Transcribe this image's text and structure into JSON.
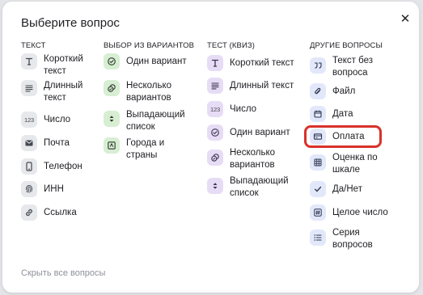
{
  "dialog": {
    "title": "Выберите вопрос",
    "close_glyph": "✕",
    "hide_all": "Скрыть все вопросы"
  },
  "columns": [
    {
      "header": "ТЕКСТ",
      "color": "#e7e8eb",
      "items": [
        {
          "label": "Короткий текст",
          "icon": "text-t-icon"
        },
        {
          "label": "Длинный текст",
          "icon": "long-text-icon"
        },
        {
          "label": "Число",
          "icon": "number-icon"
        },
        {
          "label": "Почта",
          "icon": "mail-icon"
        },
        {
          "label": "Телефон",
          "icon": "phone-icon"
        },
        {
          "label": "ИНН",
          "icon": "fingerprint-icon"
        },
        {
          "label": "Ссылка",
          "icon": "link-icon"
        }
      ]
    },
    {
      "header": "ВЫБОР ИЗ ВАРИАНТОВ",
      "color": "#d7eed3",
      "items": [
        {
          "label": "Один вариант",
          "icon": "radio-check-icon"
        },
        {
          "label": "Несколько вариантов",
          "icon": "multi-choice-icon"
        },
        {
          "label": "Выпадающий список",
          "icon": "dropdown-icon"
        },
        {
          "label": "Города и страны",
          "icon": "map-icon"
        }
      ]
    },
    {
      "header": "ТЕСТ (КВИЗ)",
      "color": "#e7dcf5",
      "items": [
        {
          "label": "Короткий текст",
          "icon": "text-t-icon"
        },
        {
          "label": "Длинный текст",
          "icon": "long-text-icon"
        },
        {
          "label": "Число",
          "icon": "number-icon"
        },
        {
          "label": "Один вариант",
          "icon": "radio-check-icon"
        },
        {
          "label": "Несколько вариантов",
          "icon": "multi-choice-icon"
        },
        {
          "label": "Выпадающий список",
          "icon": "dropdown-icon"
        }
      ]
    },
    {
      "header": "ДРУГИЕ ВОПРОСЫ",
      "color": "#e2e8fa",
      "items": [
        {
          "label": "Текст без вопроса",
          "icon": "quote-icon"
        },
        {
          "label": "Файл",
          "icon": "paperclip-icon"
        },
        {
          "label": "Дата",
          "icon": "calendar-icon"
        },
        {
          "label": "Оплата",
          "icon": "payment-card-icon"
        },
        {
          "label": "Оценка по шкале",
          "icon": "grid-scale-icon"
        },
        {
          "label": "Да/Нет",
          "icon": "checkmark-icon"
        },
        {
          "label": "Целое число",
          "icon": "hash-icon"
        },
        {
          "label": "Серия вопросов",
          "icon": "list-icon"
        }
      ]
    }
  ],
  "number_icon_text": "123",
  "highlight_color": "#d8322b"
}
